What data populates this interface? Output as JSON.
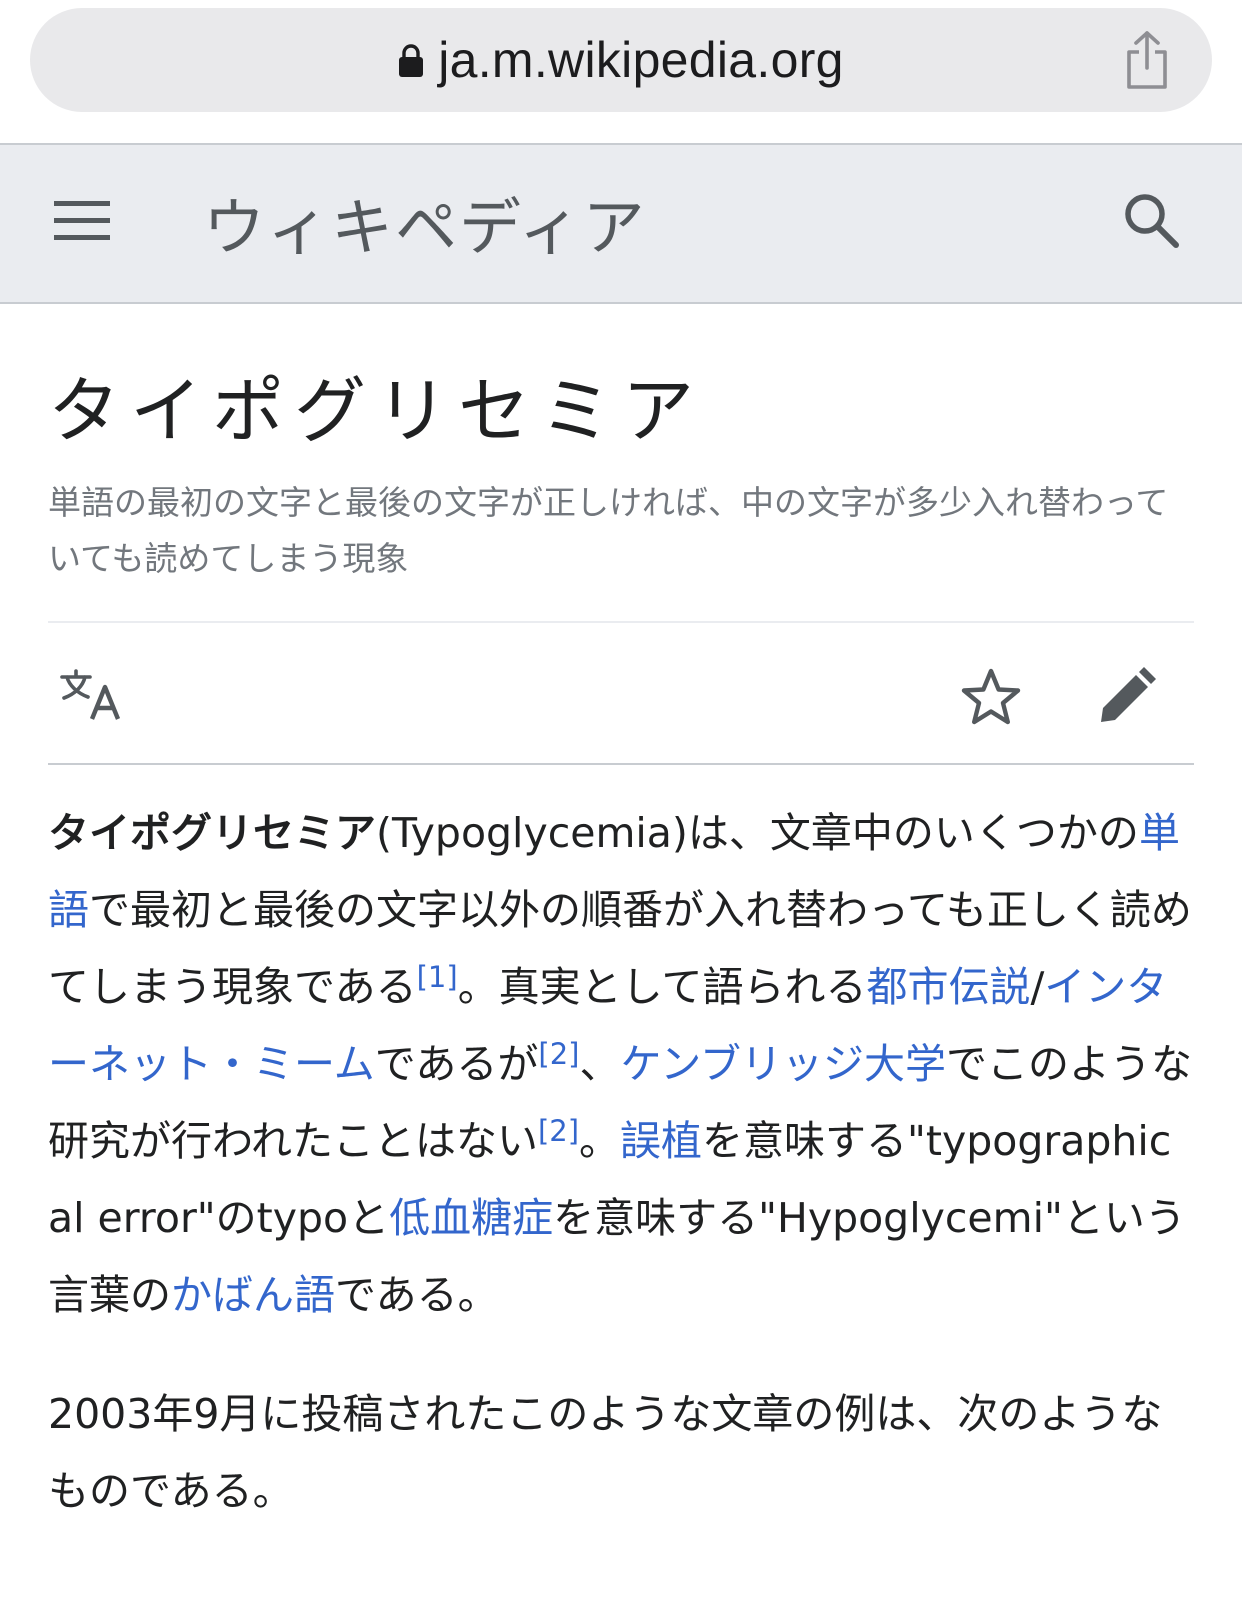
{
  "browser": {
    "url": "ja.m.wikipedia.org"
  },
  "header": {
    "wordmark": "ウィキペディア"
  },
  "article": {
    "title": "タイポグリセミア",
    "tagline": "単語の最初の文字と最後の文字が正しければ、中の文字が多少入れ替わっていても読めてしまう現象",
    "paragraph1": {
      "term": "タイポグリセミア",
      "p1": "(Typoglycemia)は、文章中のいくつかの",
      "link1": "単語",
      "p2": "で最初と最後の文字以外の順番が入れ替わっても正しく読めてしまう現象である",
      "ref1": "[1]",
      "p3": "。真実として語られる",
      "link2": "都市伝説",
      "p4": "/",
      "link3": "インターネット・ミーム",
      "p5": "であるが",
      "ref2": "[2]",
      "p6": "、",
      "link4": "ケンブリッジ大学",
      "p7": "でこのような研究が行われたことはない",
      "ref3": "[2]",
      "p8": "。",
      "link5": "誤植",
      "p9": "を意味する\"typographical error\"のtypoと",
      "link6": "低血糖症",
      "p10": "を意味する\"Hypoglycemi\"という言葉の",
      "link7": "かばん語",
      "p11": "である。"
    },
    "paragraph2": "2003年9月に投稿されたこのような文章の例は、次のようなものである。"
  },
  "colors": {
    "link": "#3366cc",
    "header_bg": "#eaecf0",
    "url_bar_bg": "#e9e9eb",
    "text": "#202122",
    "muted": "#72777d"
  },
  "icons": [
    "lock-icon",
    "share-icon",
    "menu-icon",
    "search-icon",
    "language-icon",
    "star-icon",
    "edit-icon"
  ]
}
